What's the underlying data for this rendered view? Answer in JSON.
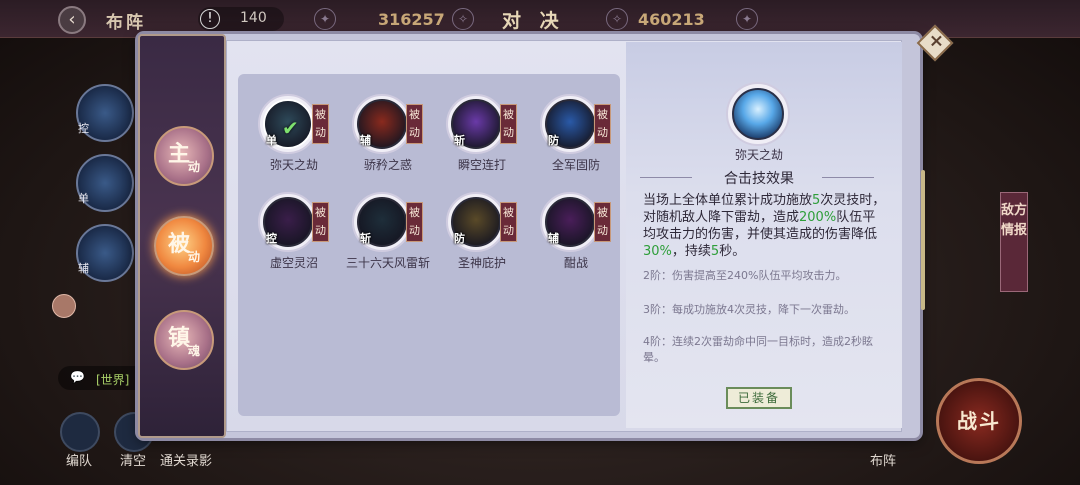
{
  "hud": {
    "title": "布阵",
    "energy": "140",
    "score_left": "316257",
    "duel_title": "对 决",
    "score_right": "460213",
    "chat_tag": "[世界]",
    "bottom_buttons": [
      "编队",
      "清空",
      "通关录影"
    ],
    "formation_label": "布阵",
    "fight_label": "战斗",
    "enemy_info_label": "敌方情报",
    "left_slots": [
      {
        "tag": "控",
        "side": "主动"
      },
      {
        "tag": "单",
        "side": "被动"
      },
      {
        "tag": "辅",
        "side": "镇魂"
      }
    ]
  },
  "categories": [
    {
      "big": "主",
      "small": "动",
      "active": false
    },
    {
      "big": "被",
      "small": "动",
      "active": true
    },
    {
      "big": "镇",
      "small": "魂",
      "active": false
    }
  ],
  "skills": [
    {
      "name": "弥天之劫",
      "role": "单",
      "badge": "被动",
      "selected": true,
      "color": "#2e4a5a"
    },
    {
      "name": "骄矜之惑",
      "role": "辅",
      "badge": "被动",
      "selected": false,
      "color": "#8a2a1e"
    },
    {
      "name": "瞬空连打",
      "role": "斩",
      "badge": "被动",
      "selected": false,
      "color": "#6a3aa8"
    },
    {
      "name": "全军固防",
      "role": "防",
      "badge": "被动",
      "selected": false,
      "color": "#2a5aa8"
    },
    {
      "name": "虚空灵沼",
      "role": "控",
      "badge": "被动",
      "selected": false,
      "color": "#3a1e4a"
    },
    {
      "name": "三十六天风雷斩",
      "role": "斩",
      "badge": "被动",
      "selected": false,
      "color": "#1e2e3a"
    },
    {
      "name": "圣神庇护",
      "role": "防",
      "badge": "被动",
      "selected": false,
      "color": "#5a4a28"
    },
    {
      "name": "酣战",
      "role": "辅",
      "badge": "被动",
      "selected": false,
      "color": "#4a1e5a"
    }
  ],
  "detail": {
    "name": "弥天之劫",
    "header": "合击技效果",
    "desc_parts": [
      {
        "t": "当场上全体单位累计成功施放",
        "hl": false
      },
      {
        "t": "5",
        "hl": true
      },
      {
        "t": "次灵技时，对随机敌人降下雷劫，造成",
        "hl": false
      },
      {
        "t": "200%",
        "hl": true
      },
      {
        "t": "队伍平均攻击力的伤害，并使其造成的伤害降低",
        "hl": false
      },
      {
        "t": "30%",
        "hl": true
      },
      {
        "t": "，持续",
        "hl": false
      },
      {
        "t": "5",
        "hl": true
      },
      {
        "t": "秒。",
        "hl": false
      }
    ],
    "tiers": [
      "2阶：伤害提高至240%队伍平均攻击力。",
      "3阶：每成功施放4次灵技，降下一次雷劫。",
      "4阶：连续2次雷劫命中同一目标时，造成2秒眩晕。"
    ],
    "equipped_label": "已装备"
  }
}
